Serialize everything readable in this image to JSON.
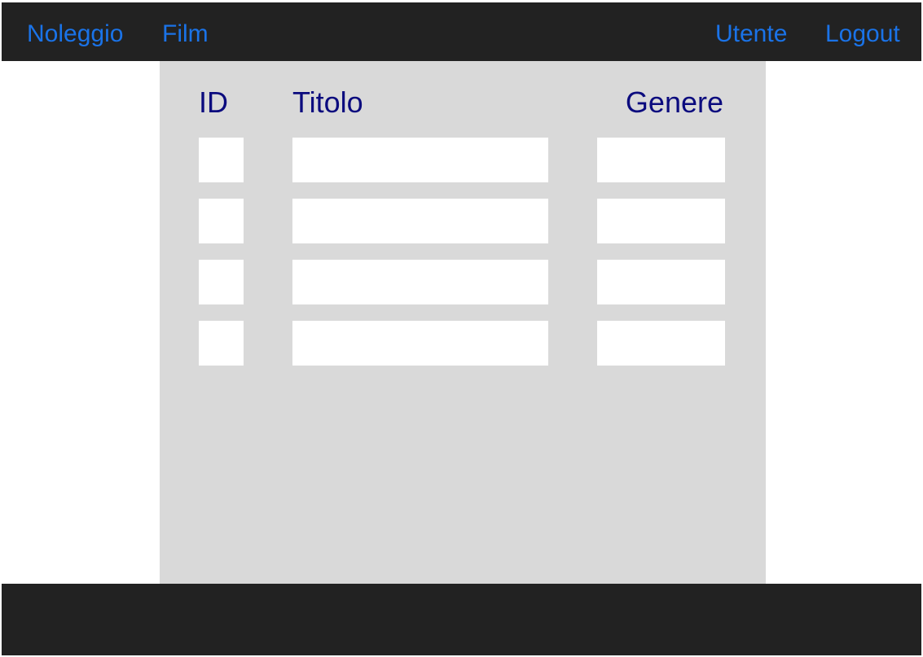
{
  "navbar": {
    "brand": "Noleggio",
    "links_left": [
      "Film"
    ],
    "links_right": [
      "Utente",
      "Logout"
    ]
  },
  "table": {
    "headers": {
      "id": "ID",
      "titolo": "Titolo",
      "genere": "Genere"
    },
    "rows": [
      {
        "id": "",
        "titolo": "",
        "genere": ""
      },
      {
        "id": "",
        "titolo": "",
        "genere": ""
      },
      {
        "id": "",
        "titolo": "",
        "genere": ""
      },
      {
        "id": "",
        "titolo": "",
        "genere": ""
      }
    ]
  },
  "colors": {
    "navbar_bg": "#222222",
    "link": "#1a73e8",
    "content_bg": "#d9d9d9",
    "header_text": "#0b0b7e",
    "cell_bg": "#ffffff"
  }
}
